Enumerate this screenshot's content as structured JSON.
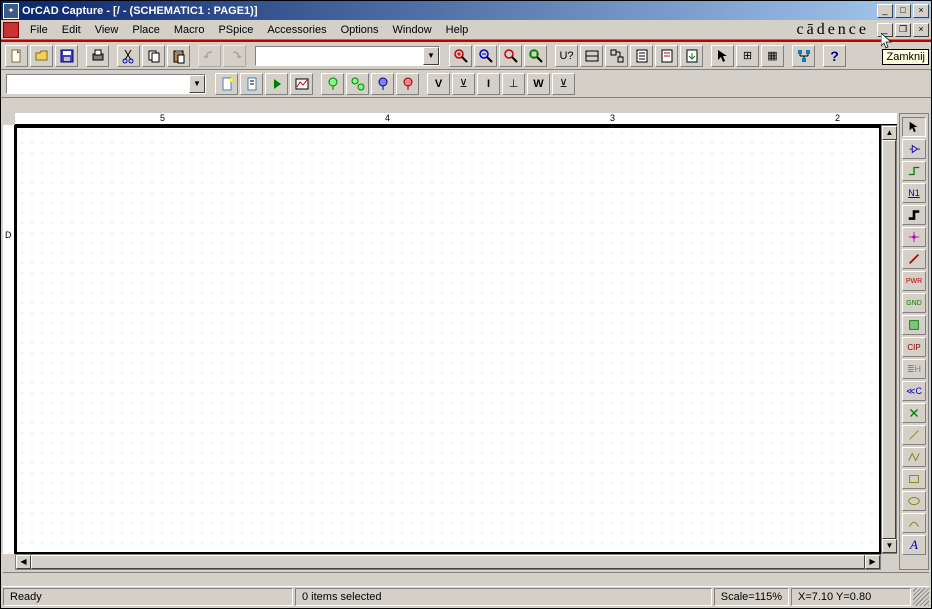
{
  "window": {
    "title": "OrCAD Capture - [/ - (SCHEMATIC1 : PAGE1)]"
  },
  "menu": {
    "items": [
      "File",
      "Edit",
      "View",
      "Place",
      "Macro",
      "PSpice",
      "Accessories",
      "Options",
      "Window",
      "Help"
    ],
    "brand": "cādence"
  },
  "toolbar1": {
    "combo_value": ""
  },
  "ruler": {
    "marks_h": [
      "5",
      "4",
      "3",
      "2"
    ],
    "marks_v": [
      "D"
    ]
  },
  "status": {
    "ready": "Ready",
    "selection": "0 items selected",
    "scale": "Scale=115%",
    "coords": "X=7.10  Y=0.80"
  },
  "tooltip": {
    "text": "Zamknij"
  },
  "palette_labels": {
    "net": "N1",
    "pwr": "PWR",
    "gnd": "GND",
    "clip": "CIP",
    "group": "≣H",
    "prev": "≪C",
    "text": "A"
  },
  "toolbar2_labels": {
    "v": "V",
    "vbar": "⊻",
    "i": "I",
    "ibar": "⊥",
    "w": "W",
    "wbar": "⊻"
  },
  "toolbar1_labels": {
    "u": "U?",
    "snap": "⊞",
    "grid": "▦"
  }
}
